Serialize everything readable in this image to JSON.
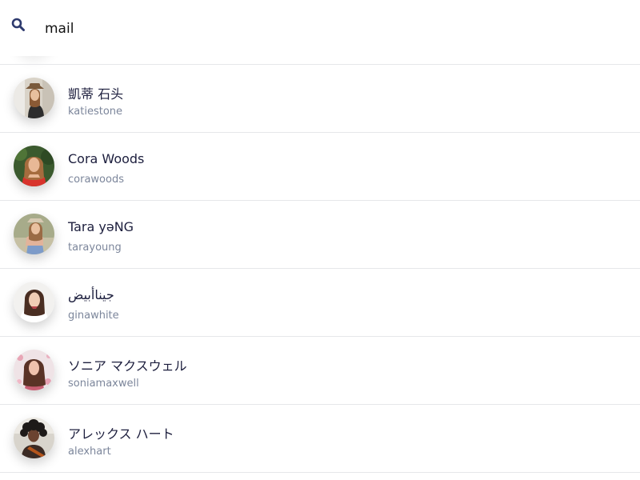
{
  "search": {
    "value": "mail",
    "icon": "search-icon"
  },
  "colors": {
    "name_text": "#1c1e3d",
    "handle_text": "#7c869b",
    "divider": "#e6e7ea",
    "search_icon": "#2e3a6e"
  },
  "users": [
    {
      "name": "凱蒂 石头",
      "handle": "katiestone"
    },
    {
      "name": "Cora Woods",
      "handle": "corawoods"
    },
    {
      "name": "Tara yəNG",
      "handle": "tarayoung"
    },
    {
      "name": "جيناأبيض",
      "handle": "ginawhite"
    },
    {
      "name": "ソニア マクスウェル",
      "handle": "soniamaxwell"
    },
    {
      "name": "アレックス ハート",
      "handle": "alexhart"
    }
  ]
}
